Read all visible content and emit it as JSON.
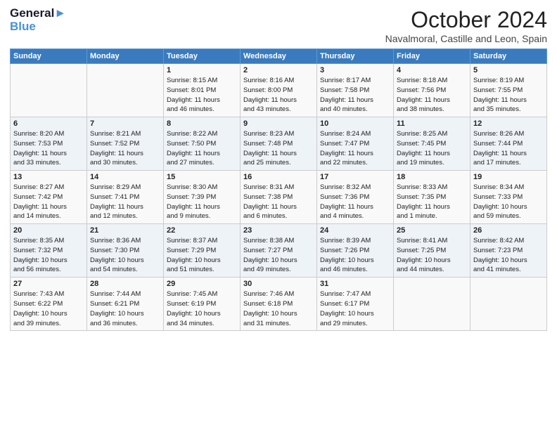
{
  "header": {
    "logo_line1": "General",
    "logo_line2": "Blue",
    "main_title": "October 2024",
    "subtitle": "Navalmoral, Castille and Leon, Spain"
  },
  "days_of_week": [
    "Sunday",
    "Monday",
    "Tuesday",
    "Wednesday",
    "Thursday",
    "Friday",
    "Saturday"
  ],
  "weeks": [
    [
      {
        "num": "",
        "info": ""
      },
      {
        "num": "",
        "info": ""
      },
      {
        "num": "1",
        "info": "Sunrise: 8:15 AM\nSunset: 8:01 PM\nDaylight: 11 hours\nand 46 minutes."
      },
      {
        "num": "2",
        "info": "Sunrise: 8:16 AM\nSunset: 8:00 PM\nDaylight: 11 hours\nand 43 minutes."
      },
      {
        "num": "3",
        "info": "Sunrise: 8:17 AM\nSunset: 7:58 PM\nDaylight: 11 hours\nand 40 minutes."
      },
      {
        "num": "4",
        "info": "Sunrise: 8:18 AM\nSunset: 7:56 PM\nDaylight: 11 hours\nand 38 minutes."
      },
      {
        "num": "5",
        "info": "Sunrise: 8:19 AM\nSunset: 7:55 PM\nDaylight: 11 hours\nand 35 minutes."
      }
    ],
    [
      {
        "num": "6",
        "info": "Sunrise: 8:20 AM\nSunset: 7:53 PM\nDaylight: 11 hours\nand 33 minutes."
      },
      {
        "num": "7",
        "info": "Sunrise: 8:21 AM\nSunset: 7:52 PM\nDaylight: 11 hours\nand 30 minutes."
      },
      {
        "num": "8",
        "info": "Sunrise: 8:22 AM\nSunset: 7:50 PM\nDaylight: 11 hours\nand 27 minutes."
      },
      {
        "num": "9",
        "info": "Sunrise: 8:23 AM\nSunset: 7:48 PM\nDaylight: 11 hours\nand 25 minutes."
      },
      {
        "num": "10",
        "info": "Sunrise: 8:24 AM\nSunset: 7:47 PM\nDaylight: 11 hours\nand 22 minutes."
      },
      {
        "num": "11",
        "info": "Sunrise: 8:25 AM\nSunset: 7:45 PM\nDaylight: 11 hours\nand 19 minutes."
      },
      {
        "num": "12",
        "info": "Sunrise: 8:26 AM\nSunset: 7:44 PM\nDaylight: 11 hours\nand 17 minutes."
      }
    ],
    [
      {
        "num": "13",
        "info": "Sunrise: 8:27 AM\nSunset: 7:42 PM\nDaylight: 11 hours\nand 14 minutes."
      },
      {
        "num": "14",
        "info": "Sunrise: 8:29 AM\nSunset: 7:41 PM\nDaylight: 11 hours\nand 12 minutes."
      },
      {
        "num": "15",
        "info": "Sunrise: 8:30 AM\nSunset: 7:39 PM\nDaylight: 11 hours\nand 9 minutes."
      },
      {
        "num": "16",
        "info": "Sunrise: 8:31 AM\nSunset: 7:38 PM\nDaylight: 11 hours\nand 6 minutes."
      },
      {
        "num": "17",
        "info": "Sunrise: 8:32 AM\nSunset: 7:36 PM\nDaylight: 11 hours\nand 4 minutes."
      },
      {
        "num": "18",
        "info": "Sunrise: 8:33 AM\nSunset: 7:35 PM\nDaylight: 11 hours\nand 1 minute."
      },
      {
        "num": "19",
        "info": "Sunrise: 8:34 AM\nSunset: 7:33 PM\nDaylight: 10 hours\nand 59 minutes."
      }
    ],
    [
      {
        "num": "20",
        "info": "Sunrise: 8:35 AM\nSunset: 7:32 PM\nDaylight: 10 hours\nand 56 minutes."
      },
      {
        "num": "21",
        "info": "Sunrise: 8:36 AM\nSunset: 7:30 PM\nDaylight: 10 hours\nand 54 minutes."
      },
      {
        "num": "22",
        "info": "Sunrise: 8:37 AM\nSunset: 7:29 PM\nDaylight: 10 hours\nand 51 minutes."
      },
      {
        "num": "23",
        "info": "Sunrise: 8:38 AM\nSunset: 7:27 PM\nDaylight: 10 hours\nand 49 minutes."
      },
      {
        "num": "24",
        "info": "Sunrise: 8:39 AM\nSunset: 7:26 PM\nDaylight: 10 hours\nand 46 minutes."
      },
      {
        "num": "25",
        "info": "Sunrise: 8:41 AM\nSunset: 7:25 PM\nDaylight: 10 hours\nand 44 minutes."
      },
      {
        "num": "26",
        "info": "Sunrise: 8:42 AM\nSunset: 7:23 PM\nDaylight: 10 hours\nand 41 minutes."
      }
    ],
    [
      {
        "num": "27",
        "info": "Sunrise: 7:43 AM\nSunset: 6:22 PM\nDaylight: 10 hours\nand 39 minutes."
      },
      {
        "num": "28",
        "info": "Sunrise: 7:44 AM\nSunset: 6:21 PM\nDaylight: 10 hours\nand 36 minutes."
      },
      {
        "num": "29",
        "info": "Sunrise: 7:45 AM\nSunset: 6:19 PM\nDaylight: 10 hours\nand 34 minutes."
      },
      {
        "num": "30",
        "info": "Sunrise: 7:46 AM\nSunset: 6:18 PM\nDaylight: 10 hours\nand 31 minutes."
      },
      {
        "num": "31",
        "info": "Sunrise: 7:47 AM\nSunset: 6:17 PM\nDaylight: 10 hours\nand 29 minutes."
      },
      {
        "num": "",
        "info": ""
      },
      {
        "num": "",
        "info": ""
      }
    ]
  ]
}
